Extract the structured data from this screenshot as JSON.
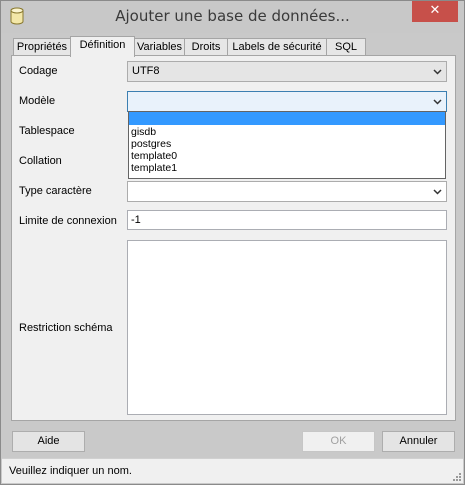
{
  "window": {
    "title": "Ajouter une base de données...",
    "close_label": "✕"
  },
  "tabs": [
    {
      "label": "Propriétés"
    },
    {
      "label": "Définition"
    },
    {
      "label": "Variables"
    },
    {
      "label": "Droits"
    },
    {
      "label": "Labels de sécurité"
    },
    {
      "label": "SQL"
    }
  ],
  "form": {
    "codage": {
      "label": "Codage",
      "value": "UTF8"
    },
    "modele": {
      "label": "Modèle",
      "value": ""
    },
    "tablespace": {
      "label": "Tablespace"
    },
    "collation": {
      "label": "Collation"
    },
    "type_caractere": {
      "label": "Type caractère",
      "value": ""
    },
    "limite_connexion": {
      "label": "Limite de connexion",
      "value": "-1"
    },
    "restriction_schema": {
      "label": "Restriction schéma",
      "value": ""
    }
  },
  "dropdown": {
    "options": [
      "",
      "gisdb",
      "postgres",
      "template0",
      "template1"
    ]
  },
  "buttons": {
    "aide": "Aide",
    "ok": "OK",
    "annuler": "Annuler"
  },
  "status": {
    "message": "Veuillez indiquer un nom."
  }
}
